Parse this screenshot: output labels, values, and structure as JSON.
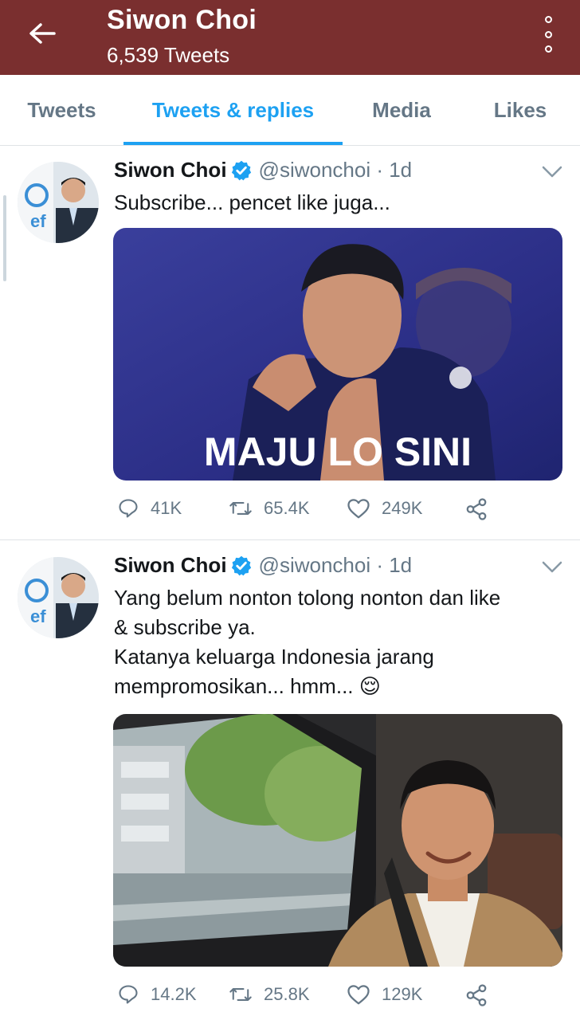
{
  "header": {
    "title": "Siwon Choi",
    "subtitle": "6,539 Tweets",
    "bg_color": "#7a2f2f",
    "back_icon": "arrow-left-icon",
    "menu_icon": "overflow-menu-icon"
  },
  "tabs": [
    {
      "label": "Tweets",
      "active": false
    },
    {
      "label": "Tweets & replies",
      "active": true
    },
    {
      "label": "Media",
      "active": false
    },
    {
      "label": "Likes",
      "active": false
    }
  ],
  "accent_color": "#1da1f2",
  "tweets": [
    {
      "name": "Siwon Choi",
      "handle": "@siwonchoi · 1d",
      "text_lines": [
        "Subscribe... pencet like juga..."
      ],
      "media_caption": "MAJU LO SINI",
      "replies": "41K",
      "retweets": "65.4K",
      "likes": "249K"
    },
    {
      "name": "Siwon Choi",
      "handle": "@siwonchoi · 1d",
      "text_lines": [
        "Yang belum nonton tolong nonton dan like",
        "& subscribe ya.",
        "Katanya keluarga Indonesia jarang",
        "mempromosikan... hmm... 😌"
      ],
      "replies": "14.2K",
      "retweets": "25.8K",
      "likes": "129K"
    }
  ]
}
